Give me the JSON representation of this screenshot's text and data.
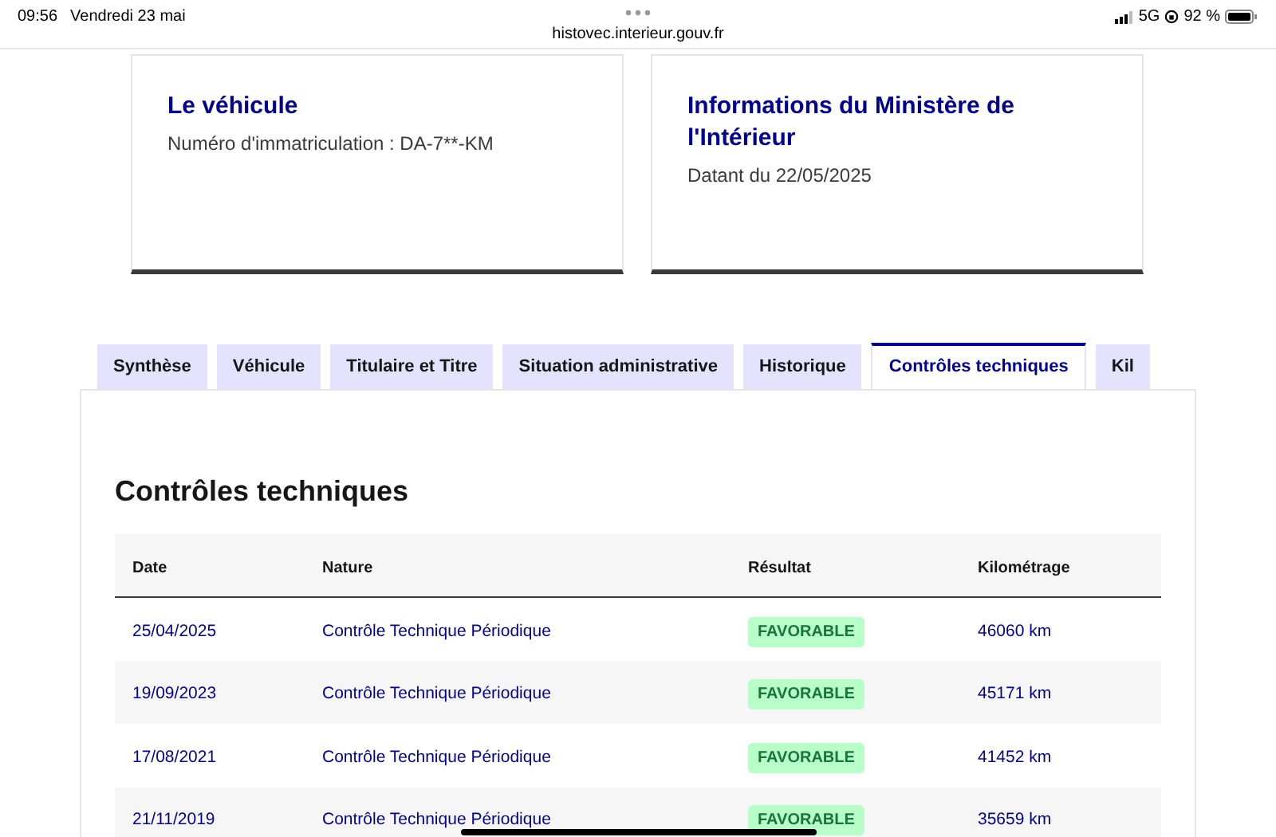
{
  "status_bar": {
    "time": "09:56",
    "date": "Vendredi 23 mai",
    "network": "5G",
    "battery": "92 %"
  },
  "address_bar": {
    "url": "histovec.interieur.gouv.fr"
  },
  "cards": [
    {
      "title": "Le véhicule",
      "text": "Numéro d'immatriculation : DA-7**-KM"
    },
    {
      "title": "Informations du Ministère de l'Intérieur",
      "text": "Datant du 22/05/2025"
    }
  ],
  "tabs": [
    {
      "label": "Synthèse",
      "selected": false
    },
    {
      "label": "Véhicule",
      "selected": false
    },
    {
      "label": "Titulaire et Titre",
      "selected": false
    },
    {
      "label": "Situation administrative",
      "selected": false
    },
    {
      "label": "Historique",
      "selected": false
    },
    {
      "label": "Contrôles techniques",
      "selected": true
    },
    {
      "label": "Kil",
      "selected": false
    }
  ],
  "section": {
    "title": "Contrôles techniques",
    "table": {
      "columns": [
        "Date",
        "Nature",
        "Résultat",
        "Kilométrage"
      ],
      "rows": [
        {
          "date": "25/04/2025",
          "nature": "Contrôle Technique Périodique",
          "result": "FAVORABLE",
          "mileage": "46060 km"
        },
        {
          "date": "19/09/2023",
          "nature": "Contrôle Technique Périodique",
          "result": "FAVORABLE",
          "mileage": "45171 km"
        },
        {
          "date": "17/08/2021",
          "nature": "Contrôle Technique Périodique",
          "result": "FAVORABLE",
          "mileage": "41452 km"
        },
        {
          "date": "21/11/2019",
          "nature": "Contrôle Technique Périodique",
          "result": "FAVORABLE",
          "mileage": "35659 km"
        }
      ]
    }
  }
}
